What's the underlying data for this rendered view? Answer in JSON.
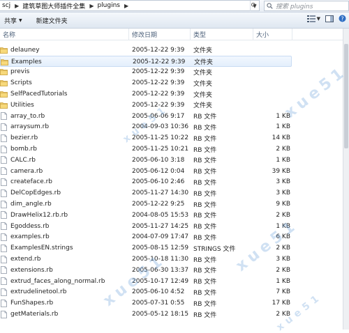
{
  "address": {
    "crumbs": [
      "scj",
      "建筑草图大师插件全集",
      "plugins"
    ]
  },
  "search": {
    "placeholder": "搜索 plugins"
  },
  "toolbar": {
    "share_label": "共享",
    "new_folder_label": "新建文件夹"
  },
  "columns": {
    "name": "名称",
    "date": "修改日期",
    "type": "类型",
    "size": "大小"
  },
  "files": [
    {
      "name": "delauney",
      "date": "2005-12-22 9:39",
      "type": "文件夹",
      "size": "",
      "icon": "folder-icon"
    },
    {
      "name": "Examples",
      "date": "2005-12-22 9:39",
      "type": "文件夹",
      "size": "",
      "icon": "folder-icon"
    },
    {
      "name": "previs",
      "date": "2005-12-22 9:39",
      "type": "文件夹",
      "size": "",
      "icon": "folder-icon"
    },
    {
      "name": "Scripts",
      "date": "2005-12-22 9:39",
      "type": "文件夹",
      "size": "",
      "icon": "folder-icon"
    },
    {
      "name": "SelfPacedTutorials",
      "date": "2005-12-22 9:39",
      "type": "文件夹",
      "size": "",
      "icon": "folder-icon"
    },
    {
      "name": "Utilities",
      "date": "2005-12-22 9:39",
      "type": "文件夹",
      "size": "",
      "icon": "folder-icon"
    },
    {
      "name": "array_to.rb",
      "date": "2005-06-06 9:17",
      "type": "RB 文件",
      "size": "1 KB",
      "icon": "file-icon"
    },
    {
      "name": "arraysum.rb",
      "date": "2004-09-03 10:36",
      "type": "RB 文件",
      "size": "1 KB",
      "icon": "file-icon"
    },
    {
      "name": "bezier.rb",
      "date": "2005-11-25 10:22",
      "type": "RB 文件",
      "size": "14 KB",
      "icon": "file-icon"
    },
    {
      "name": "bomb.rb",
      "date": "2005-11-25 10:21",
      "type": "RB 文件",
      "size": "2 KB",
      "icon": "file-icon"
    },
    {
      "name": "CALC.rb",
      "date": "2005-06-10 3:18",
      "type": "RB 文件",
      "size": "1 KB",
      "icon": "file-icon"
    },
    {
      "name": "camera.rb",
      "date": "2005-06-12 0:04",
      "type": "RB 文件",
      "size": "39 KB",
      "icon": "file-icon"
    },
    {
      "name": "createface.rb",
      "date": "2005-06-10 2:46",
      "type": "RB 文件",
      "size": "3 KB",
      "icon": "file-icon"
    },
    {
      "name": "DelCopEdges.rb",
      "date": "2005-11-27 14:30",
      "type": "RB 文件",
      "size": "3 KB",
      "icon": "file-icon"
    },
    {
      "name": "dim_angle.rb",
      "date": "2005-12-22 9:25",
      "type": "RB 文件",
      "size": "9 KB",
      "icon": "file-icon"
    },
    {
      "name": "DrawHelix12.rb.rb",
      "date": "2004-08-05 15:53",
      "type": "RB 文件",
      "size": "2 KB",
      "icon": "file-icon"
    },
    {
      "name": "Egoddess.rb",
      "date": "2005-11-27 14:25",
      "type": "RB 文件",
      "size": "1 KB",
      "icon": "file-icon"
    },
    {
      "name": "examples.rb",
      "date": "2004-07-09 17:47",
      "type": "RB 文件",
      "size": "6 KB",
      "icon": "file-icon"
    },
    {
      "name": "ExamplesEN.strings",
      "date": "2005-08-15 12:59",
      "type": "STRINGS 文件",
      "size": "2 KB",
      "icon": "file-icon"
    },
    {
      "name": "extend.rb",
      "date": "2005-10-18 11:30",
      "type": "RB 文件",
      "size": "3 KB",
      "icon": "file-icon"
    },
    {
      "name": "extensions.rb",
      "date": "2005-06-30 13:37",
      "type": "RB 文件",
      "size": "2 KB",
      "icon": "file-icon"
    },
    {
      "name": "extrud_faces_along_normal.rb",
      "date": "2005-10-17 12:49",
      "type": "RB 文件",
      "size": "1 KB",
      "icon": "file-icon"
    },
    {
      "name": "extrudelinetool.rb",
      "date": "2005-06-10 4:52",
      "type": "RB 文件",
      "size": "7 KB",
      "icon": "file-icon"
    },
    {
      "name": "FunShapes.rb",
      "date": "2005-07-31 0:55",
      "type": "RB 文件",
      "size": "17 KB",
      "icon": "file-icon"
    },
    {
      "name": "getMaterials.rb",
      "date": "2005-05-12 18:15",
      "type": "RB 文件",
      "size": "2 KB",
      "icon": "file-icon"
    }
  ],
  "selected_row_index": 1,
  "colors": {
    "selection": "#e4effc",
    "folder": "#e8c15a",
    "header_text": "#4c607a"
  }
}
